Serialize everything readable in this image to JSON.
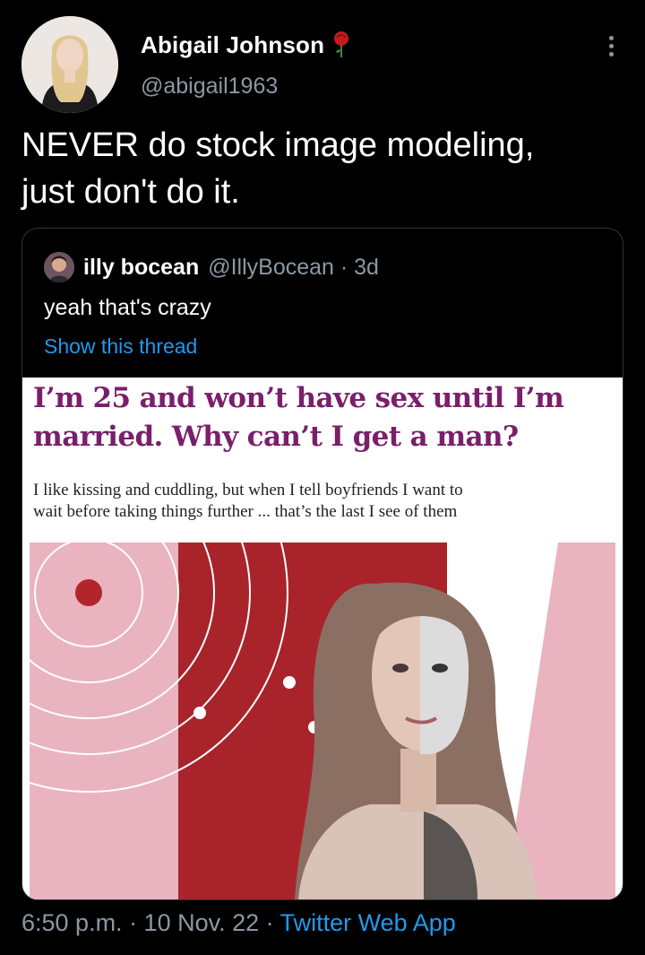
{
  "tweet": {
    "author_name": "Abigail Johnson",
    "author_handle": "@abigail1963",
    "text_line1": "NEVER do stock image modeling,",
    "text_line2": "just don't do it.",
    "timestamp": "6:50 p.m. · 10 Nov. 22 · ",
    "source": "Twitter Web App"
  },
  "quoted": {
    "name": "illy bocean",
    "handle": "@IllyBocean · 3d",
    "text": "yeah that's crazy",
    "show_thread": "Show this thread"
  },
  "article": {
    "headline_line1": "I’m 25 and won’t have sex until I’m",
    "headline_line2": "married. Why can’t I get a man?",
    "standfirst_line1": "I like kissing and cuddling, but when I tell boyfriends I want to",
    "standfirst_line2": "wait before taking things further ... that’s the last I see of them"
  },
  "colors": {
    "link": "#1d9bf0",
    "secondary_text": "#8b98a5",
    "headline": "#7a1f6b",
    "art_red": "#a8242a",
    "art_pink": "#e9b3c0"
  },
  "icons": [
    "rose-icon",
    "more-options-icon"
  ]
}
